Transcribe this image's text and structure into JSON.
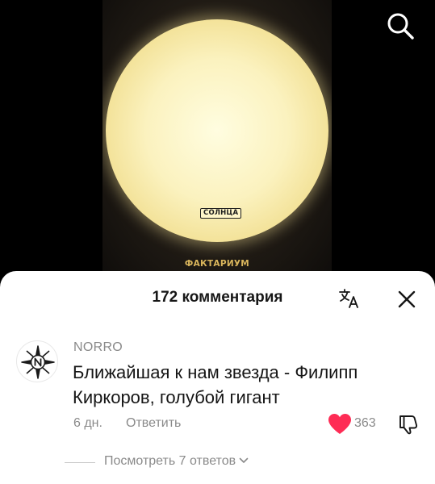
{
  "video": {
    "sun_label": "СОЛНЦА",
    "watermark": "ФАКТАРИУМ"
  },
  "toolbar": {
    "search_icon": "search-icon"
  },
  "comments_sheet": {
    "title": "172 комментария",
    "translate_icon": "translate-icon",
    "close_icon": "close-icon",
    "comment": {
      "username": "NORRO",
      "text": "Ближайшая к нам звезда - Филипп Киркоров, голубой гигант",
      "date": "6 дн.",
      "reply_label": "Ответить",
      "like_count": "363",
      "like_color": "#fe2c55",
      "liked": true
    },
    "view_replies_label": "Посмотреть 7 ответов"
  }
}
